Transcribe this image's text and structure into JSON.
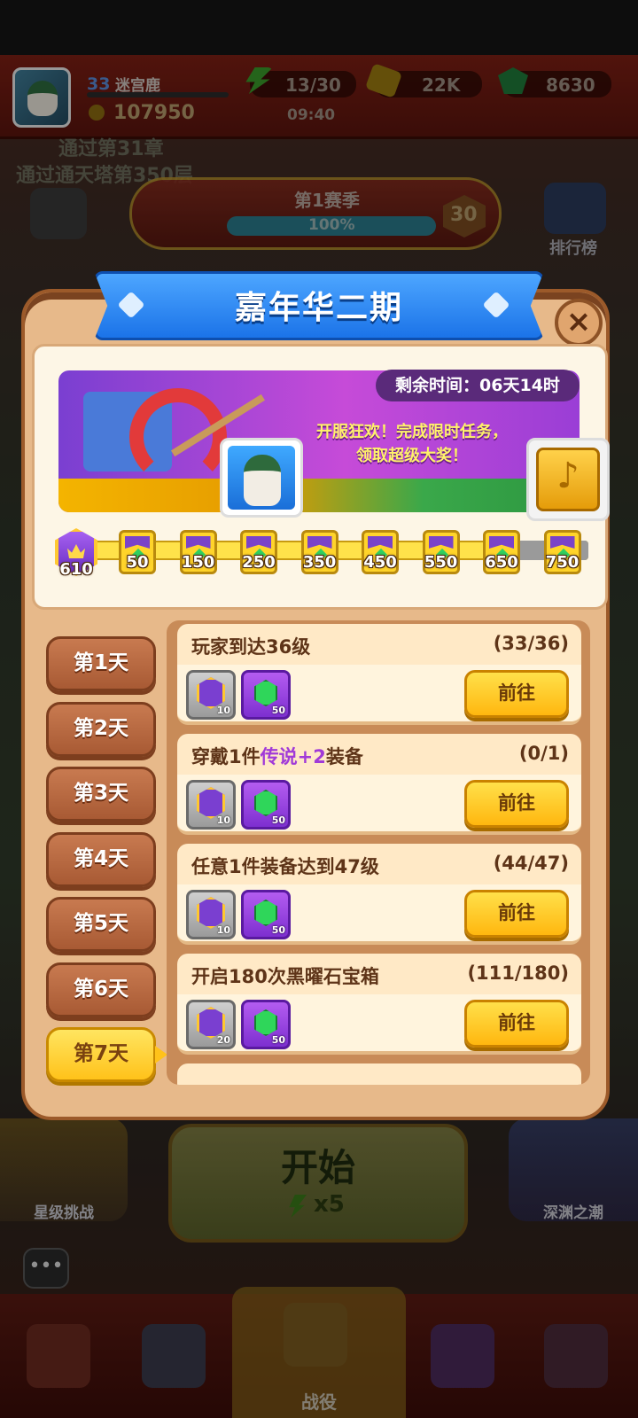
{
  "hud": {
    "level": "33",
    "player_name": "迷宫鹿",
    "power": "107950",
    "energy": "13/30",
    "energy_timer": "09:40",
    "gold": "22K",
    "gems": "8630"
  },
  "background": {
    "quest_line1": "通过第31章",
    "quest_line2": "通过通天塔第350层",
    "season_title": "第1赛季",
    "season_progress_text": "100%",
    "season_progress": 1.0,
    "season_level": "30",
    "ranking_label": "排行榜",
    "start_label": "开始",
    "start_cost": "x5",
    "left_mode_label": "星级挑战",
    "right_mode_label": "深渊之潮",
    "nav_active_label": "战役"
  },
  "modal": {
    "title": "嘉年华二期",
    "close_icon": "close-icon",
    "timer_text": "剩余时间：06天14时",
    "promo_line1": "开服狂欢！完成限时任务，",
    "promo_line2": "领取超级大奖！",
    "current_points": "610",
    "milestones": [
      "50",
      "150",
      "250",
      "350",
      "450",
      "550",
      "650",
      "750"
    ],
    "milestones_reached": 6,
    "days": [
      "第1天",
      "第2天",
      "第3天",
      "第4天",
      "第5天",
      "第6天",
      "第7天"
    ],
    "active_day_index": 6,
    "tasks": [
      {
        "title_pre": "玩家到达36级",
        "title_hl": "",
        "title_post": "",
        "progress": "(33/36)",
        "crown_qty": "10",
        "gem_qty": "50",
        "button": "前往"
      },
      {
        "title_pre": "穿戴1件",
        "title_hl": "传说+2",
        "title_post": "装备",
        "progress": "(0/1)",
        "crown_qty": "10",
        "gem_qty": "50",
        "button": "前往"
      },
      {
        "title_pre": "任意1件装备达到47级",
        "title_hl": "",
        "title_post": "",
        "progress": "(44/47)",
        "crown_qty": "10",
        "gem_qty": "50",
        "button": "前往"
      },
      {
        "title_pre": "开启180次黑曜石宝箱",
        "title_hl": "",
        "title_post": "",
        "progress": "(111/180)",
        "crown_qty": "20",
        "gem_qty": "50",
        "button": "前往"
      }
    ]
  },
  "colors": {
    "modal_bg": "#e7b98a",
    "title_blue": "#1b73e8",
    "button_yellow": "#ffc21a",
    "legend_purple": "#a13ad8"
  }
}
